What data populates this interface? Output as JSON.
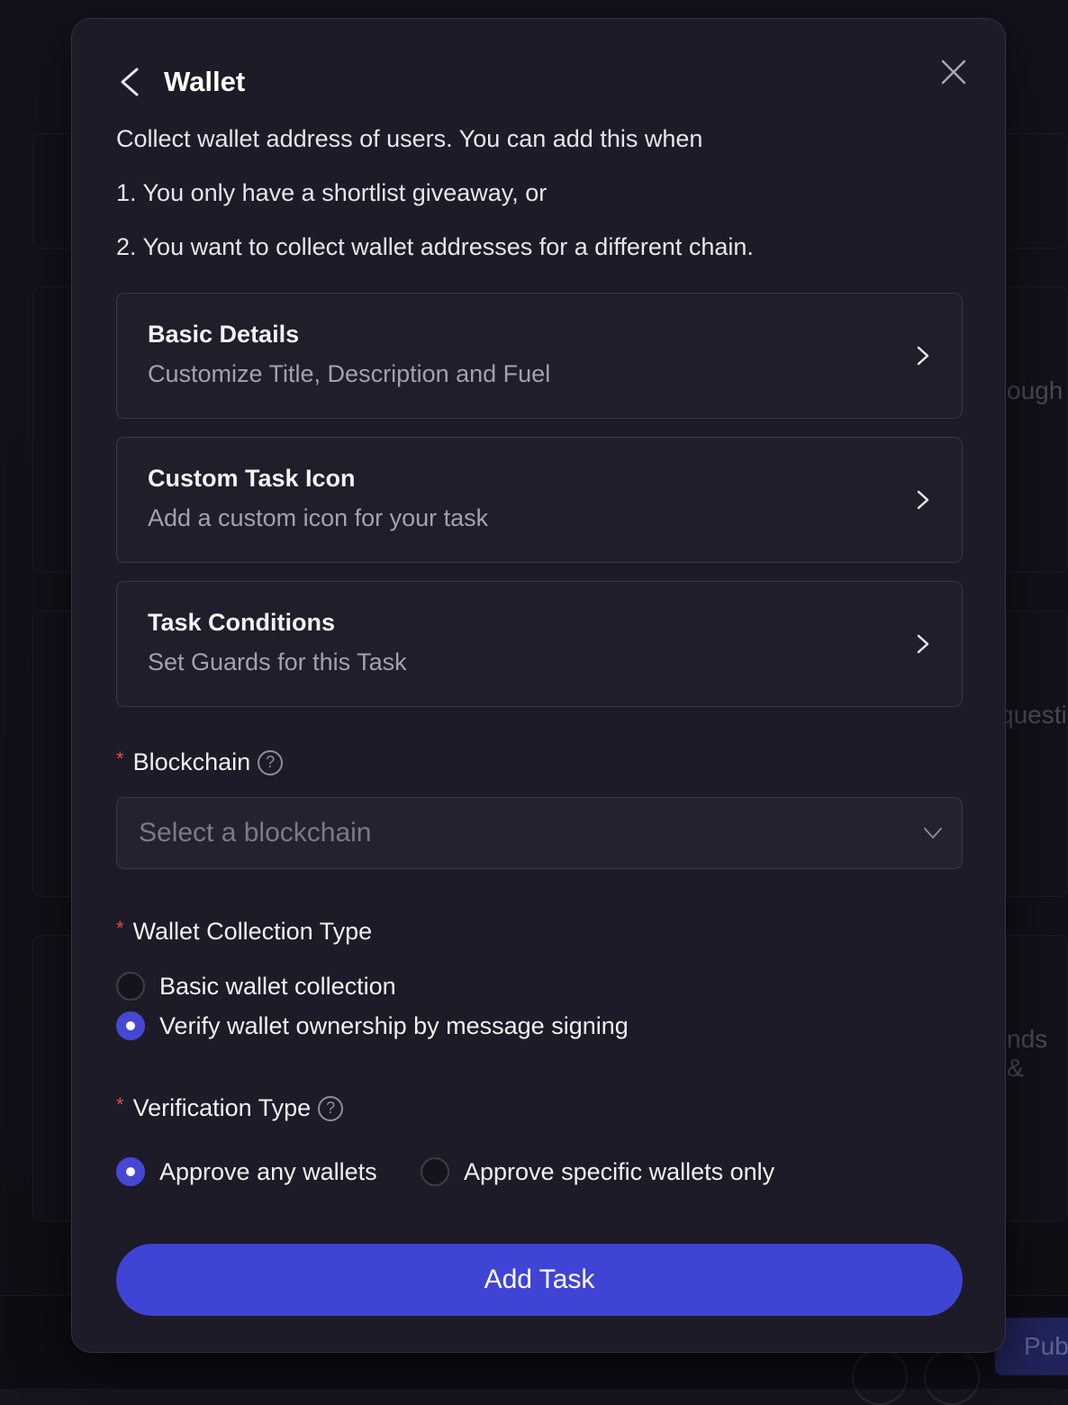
{
  "background": {
    "snippets": [
      "ough",
      "questi",
      "nds &"
    ],
    "publish_label": "Pub"
  },
  "modal": {
    "title": "Wallet",
    "description": [
      "Collect wallet address of users. You can add this when",
      "1. You only have a shortlist giveaway, or",
      "2. You want to collect wallet addresses for a different chain."
    ],
    "options": [
      {
        "title": "Basic Details",
        "subtitle": "Customize Title, Description and Fuel"
      },
      {
        "title": "Custom Task Icon",
        "subtitle": "Add a custom icon for your task"
      },
      {
        "title": "Task Conditions",
        "subtitle": "Set Guards for this Task"
      }
    ],
    "blockchain": {
      "label": "Blockchain",
      "placeholder": "Select a blockchain"
    },
    "wallet_collection": {
      "label": "Wallet Collection Type",
      "options": [
        {
          "label": "Basic wallet collection",
          "selected": false
        },
        {
          "label": "Verify wallet ownership by message signing",
          "selected": true
        }
      ]
    },
    "verification": {
      "label": "Verification Type",
      "options": [
        {
          "label": "Approve any wallets",
          "selected": true
        },
        {
          "label": "Approve specific wallets only",
          "selected": false
        }
      ]
    },
    "submit_label": "Add Task",
    "required_marker": "*",
    "help_glyph": "?"
  },
  "colors": {
    "accent": "#4044d4",
    "required": "#e5484d",
    "modal_bg": "#1c1b27"
  }
}
